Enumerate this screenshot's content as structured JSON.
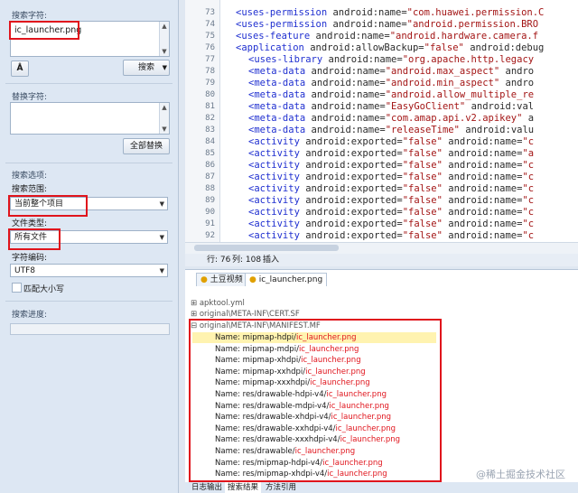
{
  "left": {
    "search_label": "搜索字符:",
    "search_value": "ic_launcher.png",
    "search_button": "搜索",
    "replace_label": "替换字符:",
    "replace_all_button": "全部替换",
    "options_label": "搜索选项:",
    "scope_label": "搜索范围:",
    "scope_value": "当前整个项目",
    "filetype_label": "文件类型:",
    "filetype_value": "所有文件",
    "encoding_label": "字符编码:",
    "encoding_value": "UTF8",
    "match_case_label": "匹配大小写",
    "progress_label": "搜索进度:"
  },
  "code_lines": [
    {
      "n": "73",
      "indent": 2,
      "parts": [
        [
          "tag",
          "<uses-permission "
        ],
        [
          "attr",
          "android:name="
        ],
        [
          "val",
          "\"com.huawei.permission.C"
        ]
      ]
    },
    {
      "n": "74",
      "indent": 2,
      "parts": [
        [
          "tag",
          "<uses-permission "
        ],
        [
          "attr",
          "android:name="
        ],
        [
          "val",
          "\"android.permission.BRO"
        ]
      ]
    },
    {
      "n": "75",
      "indent": 2,
      "parts": [
        [
          "tag",
          "<uses-feature "
        ],
        [
          "attr",
          "android:name="
        ],
        [
          "val",
          "\"android.hardware.camera.f"
        ]
      ]
    },
    {
      "n": "76",
      "indent": 2,
      "parts": [
        [
          "tag",
          "<application "
        ],
        [
          "attr",
          "android:allowBackup="
        ],
        [
          "val",
          "\"false\" "
        ],
        [
          "attr",
          "android:debug"
        ]
      ]
    },
    {
      "n": "77",
      "indent": 4,
      "parts": [
        [
          "tag",
          "<uses-library "
        ],
        [
          "attr",
          "android:name="
        ],
        [
          "val",
          "\"org.apache.http.legacy"
        ]
      ]
    },
    {
      "n": "78",
      "indent": 4,
      "parts": [
        [
          "tag",
          "<meta-data "
        ],
        [
          "attr",
          "android:name="
        ],
        [
          "val",
          "\"android.max_aspect\" "
        ],
        [
          "attr",
          "andro"
        ]
      ]
    },
    {
      "n": "79",
      "indent": 4,
      "parts": [
        [
          "tag",
          "<meta-data "
        ],
        [
          "attr",
          "android:name="
        ],
        [
          "val",
          "\"android.min_aspect\" "
        ],
        [
          "attr",
          "andro"
        ]
      ]
    },
    {
      "n": "80",
      "indent": 4,
      "parts": [
        [
          "tag",
          "<meta-data "
        ],
        [
          "attr",
          "android:name="
        ],
        [
          "val",
          "\"android.allow_multiple_re"
        ]
      ]
    },
    {
      "n": "81",
      "indent": 4,
      "parts": [
        [
          "tag",
          "<meta-data "
        ],
        [
          "attr",
          "android:name="
        ],
        [
          "val",
          "\"EasyGoClient\" "
        ],
        [
          "attr",
          "android:val"
        ]
      ]
    },
    {
      "n": "82",
      "indent": 4,
      "parts": [
        [
          "tag",
          "<meta-data "
        ],
        [
          "attr",
          "android:name="
        ],
        [
          "val",
          "\"com.amap.api.v2.apikey\" "
        ],
        [
          "attr",
          "a"
        ]
      ]
    },
    {
      "n": "83",
      "indent": 4,
      "parts": [
        [
          "tag",
          "<meta-data "
        ],
        [
          "attr",
          "android:name="
        ],
        [
          "val",
          "\"releaseTime\" "
        ],
        [
          "attr",
          "android:valu"
        ]
      ]
    },
    {
      "n": "84",
      "indent": 4,
      "parts": [
        [
          "tag",
          "<activity "
        ],
        [
          "attr",
          "android:exported="
        ],
        [
          "val",
          "\"false\" "
        ],
        [
          "attr",
          "android:name="
        ],
        [
          "val",
          "\"c"
        ]
      ]
    },
    {
      "n": "85",
      "indent": 4,
      "parts": [
        [
          "tag",
          "<activity "
        ],
        [
          "attr",
          "android:exported="
        ],
        [
          "val",
          "\"false\" "
        ],
        [
          "attr",
          "android:name="
        ],
        [
          "val",
          "\"a"
        ]
      ]
    },
    {
      "n": "86",
      "indent": 4,
      "parts": [
        [
          "tag",
          "<activity "
        ],
        [
          "attr",
          "android:exported="
        ],
        [
          "val",
          "\"false\" "
        ],
        [
          "attr",
          "android:name="
        ],
        [
          "val",
          "\"c"
        ]
      ]
    },
    {
      "n": "87",
      "indent": 4,
      "parts": [
        [
          "tag",
          "<activity "
        ],
        [
          "attr",
          "android:exported="
        ],
        [
          "val",
          "\"false\" "
        ],
        [
          "attr",
          "android:name="
        ],
        [
          "val",
          "\"c"
        ]
      ]
    },
    {
      "n": "88",
      "indent": 4,
      "parts": [
        [
          "tag",
          "<activity "
        ],
        [
          "attr",
          "android:exported="
        ],
        [
          "val",
          "\"false\" "
        ],
        [
          "attr",
          "android:name="
        ],
        [
          "val",
          "\"c"
        ]
      ]
    },
    {
      "n": "89",
      "indent": 4,
      "parts": [
        [
          "tag",
          "<activity "
        ],
        [
          "attr",
          "android:exported="
        ],
        [
          "val",
          "\"false\" "
        ],
        [
          "attr",
          "android:name="
        ],
        [
          "val",
          "\"c"
        ]
      ]
    },
    {
      "n": "90",
      "indent": 4,
      "parts": [
        [
          "tag",
          "<activity "
        ],
        [
          "attr",
          "android:exported="
        ],
        [
          "val",
          "\"false\" "
        ],
        [
          "attr",
          "android:name="
        ],
        [
          "val",
          "\"c"
        ]
      ]
    },
    {
      "n": "91",
      "indent": 4,
      "parts": [
        [
          "tag",
          "<activity "
        ],
        [
          "attr",
          "android:exported="
        ],
        [
          "val",
          "\"false\" "
        ],
        [
          "attr",
          "android:name="
        ],
        [
          "val",
          "\"c"
        ]
      ]
    },
    {
      "n": "92",
      "indent": 4,
      "parts": [
        [
          "tag",
          "<activity "
        ],
        [
          "attr",
          "android:exported="
        ],
        [
          "val",
          "\"false\" "
        ],
        [
          "attr",
          "android:name="
        ],
        [
          "val",
          "\"c"
        ]
      ]
    }
  ],
  "status": {
    "line": "行: 76",
    "col": "列: 108",
    "mode": "插入"
  },
  "tabs": [
    "土豆视频",
    "ic_launcher.png"
  ],
  "tree": {
    "nodes": [
      "apktool.yml",
      "original\\META-INF\\CERT.SF",
      "original\\META-INF\\MANIFEST.MF"
    ],
    "results": [
      {
        "prefix": "Name: mipmap-hdpi/",
        "match": "ic_launcher.png"
      },
      {
        "prefix": "Name: mipmap-mdpi/",
        "match": "ic_launcher.png"
      },
      {
        "prefix": "Name: mipmap-xhdpi/",
        "match": "ic_launcher.png"
      },
      {
        "prefix": "Name: mipmap-xxhdpi/",
        "match": "ic_launcher.png"
      },
      {
        "prefix": "Name: mipmap-xxxhdpi/",
        "match": "ic_launcher.png"
      },
      {
        "prefix": "Name: res/drawable-hdpi-v4/",
        "match": "ic_launcher.png"
      },
      {
        "prefix": "Name: res/drawable-mdpi-v4/",
        "match": "ic_launcher.png"
      },
      {
        "prefix": "Name: res/drawable-xhdpi-v4/",
        "match": "ic_launcher.png"
      },
      {
        "prefix": "Name: res/drawable-xxhdpi-v4/",
        "match": "ic_launcher.png"
      },
      {
        "prefix": "Name: res/drawable-xxxhdpi-v4/",
        "match": "ic_launcher.png"
      },
      {
        "prefix": "Name: res/drawable/",
        "match": "ic_launcher.png"
      },
      {
        "prefix": "Name: res/mipmap-hdpi-v4/",
        "match": "ic_launcher.png"
      },
      {
        "prefix": "Name: res/mipmap-xhdpi-v4/",
        "match": "ic_launcher.png"
      }
    ]
  },
  "footer_tabs": [
    "日志输出",
    "搜索结果",
    "方法引用"
  ],
  "watermark": "@稀土掘金技术社区",
  "colors": {
    "highlight": "#fff3b0",
    "accent_red": "#e0141c"
  }
}
